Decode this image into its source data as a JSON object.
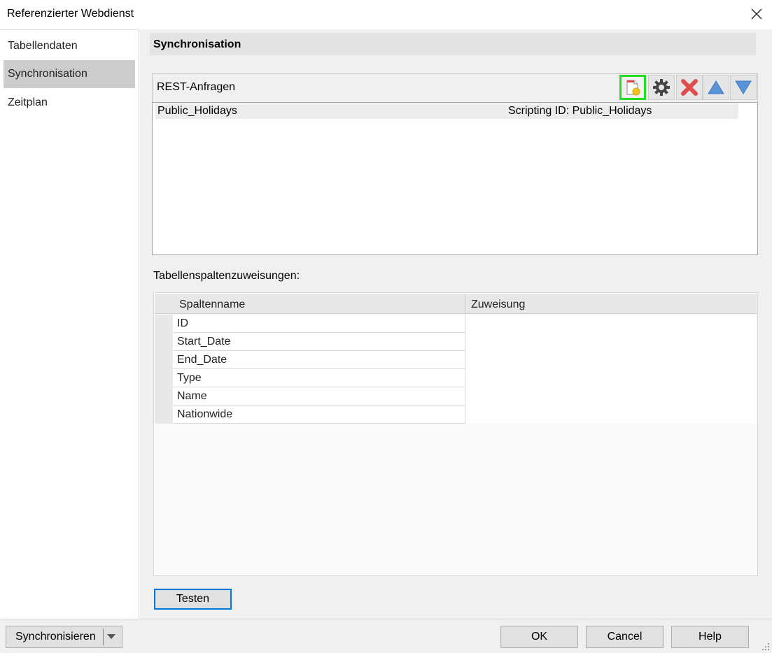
{
  "window": {
    "title": "Referenzierter Webdienst"
  },
  "sidebar": {
    "items": [
      {
        "label": "Tabellendaten",
        "selected": false
      },
      {
        "label": "Synchronisation",
        "selected": true
      },
      {
        "label": "Zeitplan",
        "selected": false
      }
    ]
  },
  "main": {
    "section_title": "Synchronisation",
    "rest": {
      "label": "REST-Anfragen",
      "toolbar_icons": [
        "new-request-icon",
        "gear-icon",
        "delete-icon",
        "move-up-icon",
        "move-down-icon"
      ],
      "rows": [
        {
          "name": "Public_Holidays",
          "scripting_id": "Scripting ID: Public_Holidays"
        }
      ]
    },
    "mappings": {
      "label": "Tabellenspaltenzuweisungen:",
      "columns": [
        "Spaltenname",
        "Zuweisung"
      ],
      "rows": [
        {
          "name": "ID"
        },
        {
          "name": "Start_Date"
        },
        {
          "name": "End_Date"
        },
        {
          "name": "Type"
        },
        {
          "name": "Name"
        },
        {
          "name": "Nationwide"
        }
      ]
    },
    "test_button": "Testen"
  },
  "footer": {
    "sync_button": "Synchronisieren",
    "ok": "OK",
    "cancel": "Cancel",
    "help": "Help"
  },
  "colors": {
    "highlight": "#22dd22",
    "selected_nav": "#cccccc",
    "focus_border": "#0078d7"
  }
}
